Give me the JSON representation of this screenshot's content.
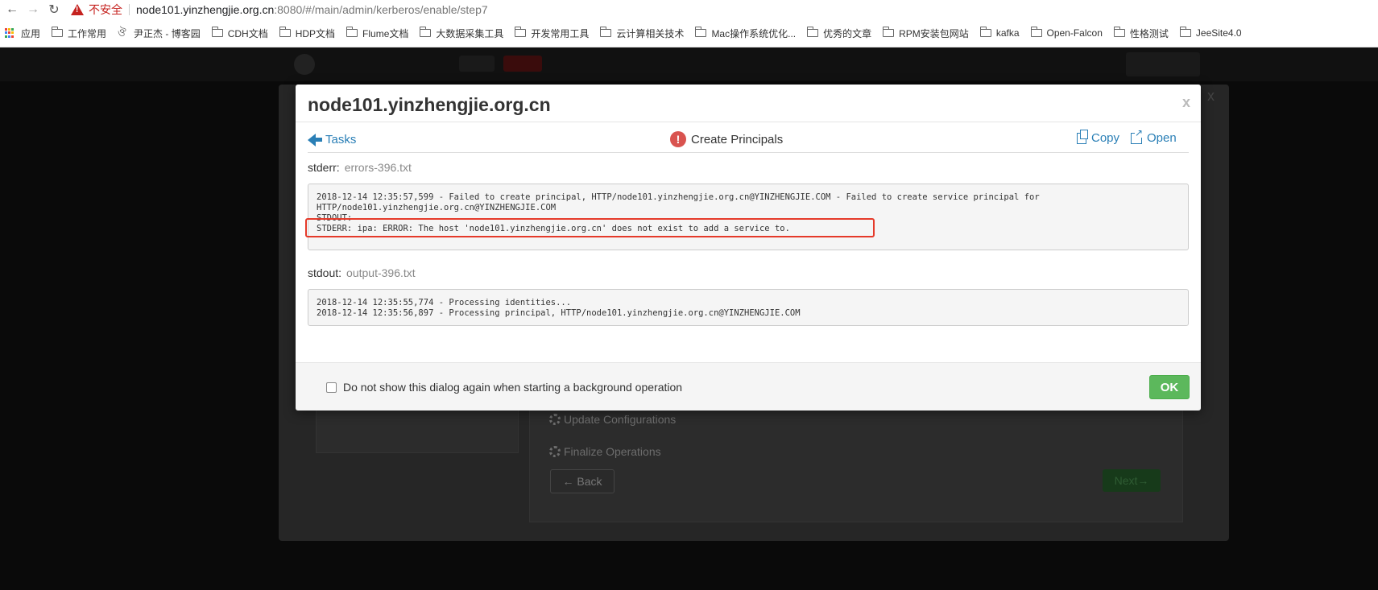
{
  "browser": {
    "insecure_label": "不安全",
    "url_host": "node101.yinzhengjie.org.cn",
    "url_rest": ":8080/#/main/admin/kerberos/enable/step7",
    "bookmarks": [
      {
        "label": "应用",
        "icon": "apps-icon"
      },
      {
        "label": "工作常用",
        "icon": "folder-icon"
      },
      {
        "label": "尹正杰 - 博客园",
        "icon": "blog-icon"
      },
      {
        "label": "CDH文档",
        "icon": "folder-icon"
      },
      {
        "label": "HDP文档",
        "icon": "folder-icon"
      },
      {
        "label": "Flume文档",
        "icon": "folder-icon"
      },
      {
        "label": "大数据采集工具",
        "icon": "folder-icon"
      },
      {
        "label": "开发常用工具",
        "icon": "folder-icon"
      },
      {
        "label": "云计算相关技术",
        "icon": "folder-icon"
      },
      {
        "label": "Mac操作系统优化...",
        "icon": "folder-icon"
      },
      {
        "label": "优秀的文章",
        "icon": "folder-icon"
      },
      {
        "label": "RPM安装包网站",
        "icon": "folder-icon"
      },
      {
        "label": "kafka",
        "icon": "folder-icon"
      },
      {
        "label": "Open-Falcon",
        "icon": "folder-icon"
      },
      {
        "label": "性格测试",
        "icon": "folder-icon"
      },
      {
        "label": "JeeSite4.0",
        "icon": "folder-icon"
      }
    ]
  },
  "background": {
    "step_update": "Update Configurations",
    "step_finalize": "Finalize Operations",
    "back_label": "← Back",
    "next_label": "Next→"
  },
  "modal": {
    "title": "node101.yinzhengjie.org.cn",
    "close_label": "x",
    "tasks_label": "Tasks",
    "task_name": "Create Principals",
    "copy_label": "Copy",
    "open_label": "Open",
    "stderr_label": "stderr:",
    "stderr_file": "errors-396.txt",
    "stderr_lines": [
      "2018-12-14 12:35:57,599 - Failed to create principal, HTTP/node101.yinzhengjie.org.cn@YINZHENGJIE.COM - Failed to create service principal for",
      "HTTP/node101.yinzhengjie.org.cn@YINZHENGJIE.COM",
      "STDOUT:",
      "STDERR: ipa: ERROR: The host 'node101.yinzhengjie.org.cn' does not exist to add a service to."
    ],
    "stdout_label": "stdout:",
    "stdout_file": "output-396.txt",
    "stdout_lines": [
      "2018-12-14 12:35:55,774 - Processing identities...",
      "2018-12-14 12:35:56,897 - Processing principal, HTTP/node101.yinzhengjie.org.cn@YINZHENGJIE.COM"
    ],
    "dont_show_label": "Do not show this dialog again when starting a background operation",
    "ok_label": "OK"
  },
  "colors": {
    "link": "#2a7fb6",
    "error": "#d9534f",
    "ok": "#5cb85c",
    "highlight": "#e53a2a"
  }
}
